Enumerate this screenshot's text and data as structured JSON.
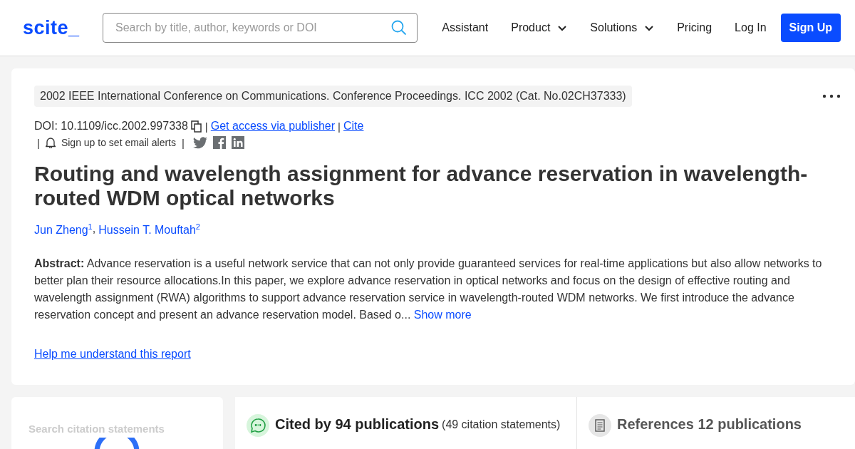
{
  "header": {
    "logo": "scite_",
    "search": {
      "placeholder": "Search by title, author, keywords or DOI"
    },
    "nav": [
      {
        "label": "Assistant",
        "kind": "link"
      },
      {
        "label": "Product",
        "kind": "dropdown"
      },
      {
        "label": "Solutions",
        "kind": "dropdown"
      },
      {
        "label": "Pricing",
        "kind": "link"
      },
      {
        "label": "Log In",
        "kind": "link"
      },
      {
        "label": "Sign Up",
        "kind": "primary"
      }
    ]
  },
  "paper": {
    "venue": "2002 IEEE International Conference on Communications. Conference Proceedings. ICC 2002 (Cat. No.02CH37333)",
    "doi": "DOI: 10.1109/icc.2002.997338",
    "doi_separators": [
      "|",
      "|"
    ],
    "alert_separators": [
      "|",
      "|"
    ],
    "author_separators": [
      ","
    ],
    "access_link": "Get access via publisher",
    "cite_link": "Cite",
    "alerts": "Sign up to set email alerts",
    "title": "Routing and wavelength assignment for advance reservation in wavelength-routed WDM optical networks",
    "authors": [
      "Jun Zheng$^{1}$",
      "Hussein T. Mouftah$^{2}$"
    ],
    "abstract": "**Abstract:** Advance reservation is a useful network service that can not only provide guaranteed services for real-time applications but also allow networks to better plan their resource allocations.In this paper, we explore advance reservation in optical networks and focus on the design of effective routing and wavelength assignment (RWA) algorithms to support advance reservation service in wavelength-routed WDM networks. We first introduce the advance reservation concept and present an advance reservation model. Based o...",
    "show_more": "Show more",
    "help_link": "Help me understand this report"
  },
  "citations": {
    "search_placeholder": "Search citation statements",
    "cited_by": "Cited by 94 publications",
    "statements": "(49 citation statements)",
    "references": "References 12 publications"
  }
}
